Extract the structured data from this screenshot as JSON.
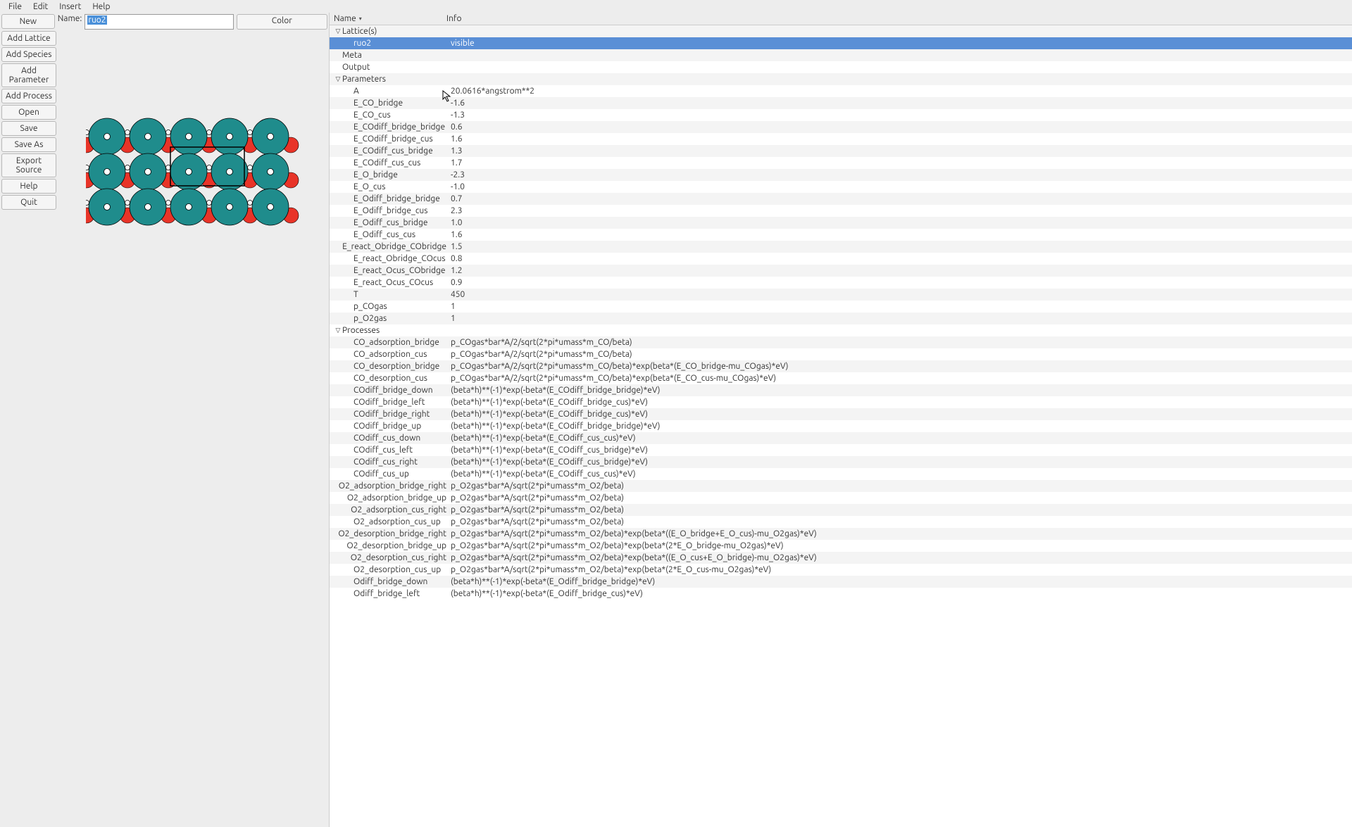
{
  "menubar": [
    "File",
    "Edit",
    "Insert",
    "Help"
  ],
  "buttons": {
    "new": "New",
    "add_lattice": "Add Lattice",
    "add_species": "Add Species",
    "add_parameter": "Add Parameter",
    "add_process": "Add Process",
    "open": "Open",
    "save": "Save",
    "save_as": "Save As",
    "export_source": "Export Source",
    "help": "Help",
    "quit": "Quit",
    "color": "Color"
  },
  "name_field": {
    "label": "Name:",
    "value": "ruo2"
  },
  "tree_header": {
    "name": "Name",
    "info": "Info"
  },
  "tree": [
    {
      "type": "group",
      "label": "Lattice(s)",
      "expanded": true,
      "children": [
        {
          "label": "ruo2",
          "info": "visible",
          "selected": true
        }
      ]
    },
    {
      "type": "row",
      "label": "Meta",
      "indent": 1
    },
    {
      "type": "row",
      "label": "Output",
      "indent": 1
    },
    {
      "type": "group",
      "label": "Parameters",
      "expanded": true,
      "children": [
        {
          "label": "A",
          "info": "20.0616*angstrom**2"
        },
        {
          "label": "E_CO_bridge",
          "info": "-1.6"
        },
        {
          "label": "E_CO_cus",
          "info": "-1.3"
        },
        {
          "label": "E_COdiff_bridge_bridge",
          "info": "0.6"
        },
        {
          "label": "E_COdiff_bridge_cus",
          "info": "1.6"
        },
        {
          "label": "E_COdiff_cus_bridge",
          "info": "1.3"
        },
        {
          "label": "E_COdiff_cus_cus",
          "info": "1.7"
        },
        {
          "label": "E_O_bridge",
          "info": "-2.3"
        },
        {
          "label": "E_O_cus",
          "info": "-1.0"
        },
        {
          "label": "E_Odiff_bridge_bridge",
          "info": "0.7"
        },
        {
          "label": "E_Odiff_bridge_cus",
          "info": "2.3"
        },
        {
          "label": "E_Odiff_cus_bridge",
          "info": "1.0"
        },
        {
          "label": "E_Odiff_cus_cus",
          "info": "1.6"
        },
        {
          "label": "E_react_Obridge_CObridge",
          "info": "1.5"
        },
        {
          "label": "E_react_Obridge_COcus",
          "info": "0.8"
        },
        {
          "label": "E_react_Ocus_CObridge",
          "info": "1.2"
        },
        {
          "label": "E_react_Ocus_COcus",
          "info": "0.9"
        },
        {
          "label": "T",
          "info": "450"
        },
        {
          "label": "p_COgas",
          "info": "1"
        },
        {
          "label": "p_O2gas",
          "info": "1"
        }
      ]
    },
    {
      "type": "group",
      "label": "Processes",
      "expanded": true,
      "children": [
        {
          "label": "CO_adsorption_bridge",
          "info": "p_COgas*bar*A/2/sqrt(2*pi*umass*m_CO/beta)"
        },
        {
          "label": "CO_adsorption_cus",
          "info": "p_COgas*bar*A/2/sqrt(2*pi*umass*m_CO/beta)"
        },
        {
          "label": "CO_desorption_bridge",
          "info": "p_COgas*bar*A/2/sqrt(2*pi*umass*m_CO/beta)*exp(beta*(E_CO_bridge-mu_COgas)*eV)"
        },
        {
          "label": "CO_desorption_cus",
          "info": "p_COgas*bar*A/2/sqrt(2*pi*umass*m_CO/beta)*exp(beta*(E_CO_cus-mu_COgas)*eV)"
        },
        {
          "label": "COdiff_bridge_down",
          "info": "(beta*h)**(-1)*exp(-beta*(E_COdiff_bridge_bridge)*eV)"
        },
        {
          "label": "COdiff_bridge_left",
          "info": "(beta*h)**(-1)*exp(-beta*(E_COdiff_bridge_cus)*eV)"
        },
        {
          "label": "COdiff_bridge_right",
          "info": "(beta*h)**(-1)*exp(-beta*(E_COdiff_bridge_cus)*eV)"
        },
        {
          "label": "COdiff_bridge_up",
          "info": "(beta*h)**(-1)*exp(-beta*(E_COdiff_bridge_bridge)*eV)"
        },
        {
          "label": "COdiff_cus_down",
          "info": "(beta*h)**(-1)*exp(-beta*(E_COdiff_cus_cus)*eV)"
        },
        {
          "label": "COdiff_cus_left",
          "info": "(beta*h)**(-1)*exp(-beta*(E_COdiff_cus_bridge)*eV)"
        },
        {
          "label": "COdiff_cus_right",
          "info": "(beta*h)**(-1)*exp(-beta*(E_COdiff_cus_bridge)*eV)"
        },
        {
          "label": "COdiff_cus_up",
          "info": "(beta*h)**(-1)*exp(-beta*(E_COdiff_cus_cus)*eV)"
        },
        {
          "label": "O2_adsorption_bridge_right",
          "info": "p_O2gas*bar*A/sqrt(2*pi*umass*m_O2/beta)"
        },
        {
          "label": "O2_adsorption_bridge_up",
          "info": "p_O2gas*bar*A/sqrt(2*pi*umass*m_O2/beta)"
        },
        {
          "label": "O2_adsorption_cus_right",
          "info": "p_O2gas*bar*A/sqrt(2*pi*umass*m_O2/beta)"
        },
        {
          "label": "O2_adsorption_cus_up",
          "info": "p_O2gas*bar*A/sqrt(2*pi*umass*m_O2/beta)"
        },
        {
          "label": "O2_desorption_bridge_right",
          "info": "p_O2gas*bar*A/sqrt(2*pi*umass*m_O2/beta)*exp(beta*((E_O_bridge+E_O_cus)-mu_O2gas)*eV)"
        },
        {
          "label": "O2_desorption_bridge_up",
          "info": "p_O2gas*bar*A/sqrt(2*pi*umass*m_O2/beta)*exp(beta*(2*E_O_bridge-mu_O2gas)*eV)"
        },
        {
          "label": "O2_desorption_cus_right",
          "info": "p_O2gas*bar*A/sqrt(2*pi*umass*m_O2/beta)*exp(beta*((E_O_cus+E_O_bridge)-mu_O2gas)*eV)"
        },
        {
          "label": "O2_desorption_cus_up",
          "info": "p_O2gas*bar*A/sqrt(2*pi*umass*m_O2/beta)*exp(beta*(2*E_O_cus-mu_O2gas)*eV)"
        },
        {
          "label": "Odiff_bridge_down",
          "info": "(beta*h)**(-1)*exp(-beta*(E_Odiff_bridge_bridge)*eV)"
        },
        {
          "label": "Odiff_bridge_left",
          "info": "(beta*h)**(-1)*exp(-beta*(E_Odiff_bridge_cus)*eV)"
        }
      ]
    }
  ]
}
